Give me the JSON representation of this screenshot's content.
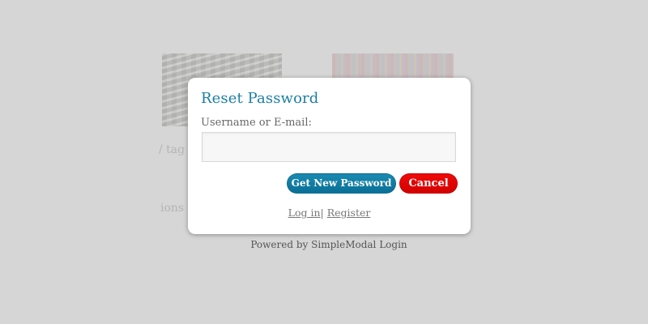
{
  "background": {
    "text_fragment_1": "/ tag",
    "text_fragment_2": "ions"
  },
  "modal": {
    "title": "Reset Password",
    "field_label": "Username or E-mail:",
    "field_value": "",
    "field_placeholder": "",
    "submit_label": "Get New Password",
    "cancel_label": "Cancel",
    "login_link": "Log in",
    "separator": "|",
    "register_link": "Register"
  },
  "footer": {
    "powered_by": "Powered by SimpleModal Login"
  },
  "colors": {
    "title": "#1b7ea3",
    "primary_button": "#0a7ba6",
    "cancel_button": "#e30000",
    "overlay": "#d6d6d6"
  }
}
